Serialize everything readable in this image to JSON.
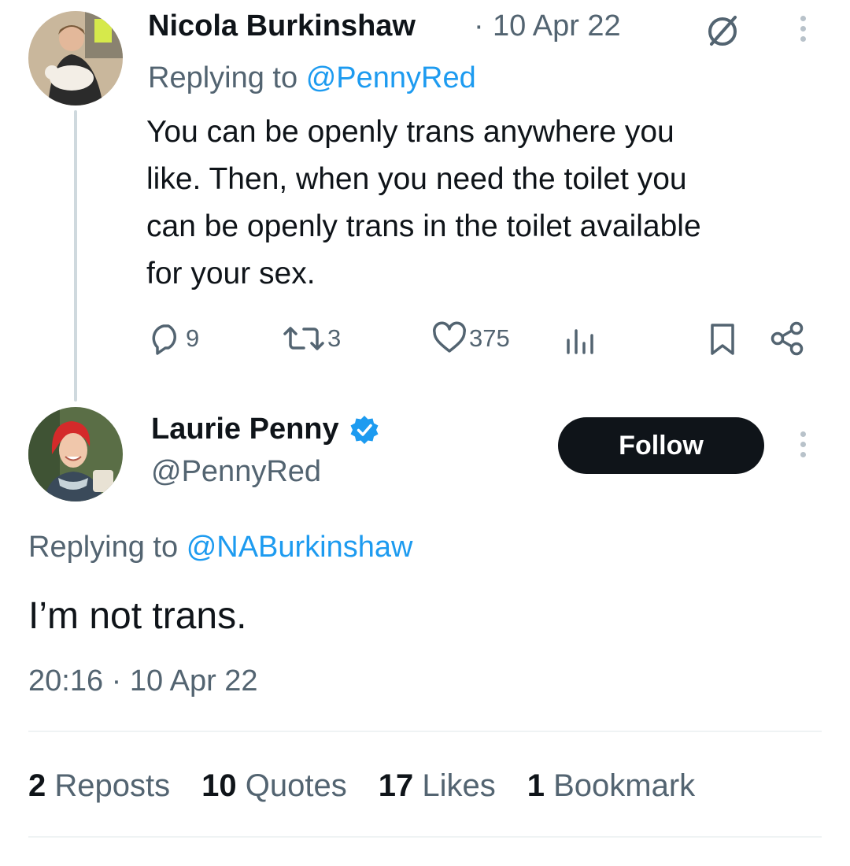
{
  "parent_tweet": {
    "author_name": "Nicola Burkinshaw",
    "separator": "·",
    "date": "10 Apr 22",
    "replying_prefix": "Replying to",
    "replying_handle": "@PennyRed",
    "text": "You can be openly trans anywhere you like. Then, when you need the toilet you can be openly trans in the toilet available for your sex.",
    "text_lines": [
      "You can be openly trans anywhere you",
      "like. Then, when you need the toilet you",
      "can be openly trans in the toilet available",
      "for your sex."
    ],
    "actions": {
      "replies": "9",
      "reposts": "3",
      "likes": "375"
    },
    "icons": [
      "no-symbol-icon",
      "more-vertical-icon",
      "reply-icon",
      "repost-icon",
      "like-icon",
      "views-icon",
      "bookmark-icon",
      "share-icon"
    ]
  },
  "main_tweet": {
    "author_name": "Laurie Penny",
    "handle": "@PennyRed",
    "verified": true,
    "follow_label": "Follow",
    "replying_prefix": "Replying to",
    "replying_handle": "@NABurkinshaw",
    "text": "I’m not trans.",
    "time": "20:16",
    "separator": "·",
    "date": "10 Apr 22",
    "stats": {
      "reposts_count": "2",
      "reposts_label": "Reposts",
      "quotes_count": "10",
      "quotes_label": "Quotes",
      "likes_count": "17",
      "likes_label": "Likes",
      "bookmarks_count": "1",
      "bookmarks_label": "Bookmark"
    }
  },
  "colors": {
    "link": "#1d9bf0",
    "muted": "#536471",
    "text": "#0f1419",
    "divider": "#eff3f4"
  }
}
